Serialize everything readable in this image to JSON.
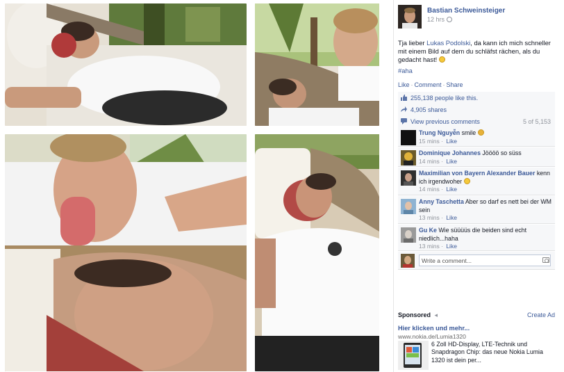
{
  "post": {
    "author": "Bastian Schweinsteiger",
    "time": "12 hrs",
    "text_prefix": "Tja lieber ",
    "mention": "Lukas Podolski",
    "text_suffix": ", da kann ich mich schneller mit einem Bild auf dem du schläfst rächen, als du gedacht hast! ",
    "hashtag": "#aha",
    "actions": {
      "like": "Like",
      "comment": "Comment",
      "share": "Share"
    },
    "likes_text": "255,138 people like this.",
    "shares_text": "4,905 shares",
    "view_previous": "View previous comments",
    "comment_count": "5 of 5,153",
    "write_placeholder": "Write a comment..."
  },
  "comments": [
    {
      "author": "Trung Nguyễn",
      "text": " smile ",
      "time": "15 mins",
      "like": "Like",
      "avatar_color": "#111111"
    },
    {
      "author": "Dominique Johannes",
      "text": " Jöööö so süss",
      "time": "14 mins",
      "like": "Like",
      "avatar_color": "#c9a22c"
    },
    {
      "author": "Maximilian von Bayern Alexander Bauer",
      "text": " kenn ich irgendwoher ",
      "time": "14 mins",
      "like": "Like",
      "avatar_color": "#3a3a3a"
    },
    {
      "author": "Anny Taschetta",
      "text": " Aber so darf es nett bei der WM sein",
      "time": "13 mins",
      "like": "Like",
      "avatar_color": "#7fa4c4"
    },
    {
      "author": "Gu Ke",
      "text": " Wie süüüüs die beiden sind echt niedlich...haha",
      "time": "13 mins",
      "like": "Like",
      "avatar_color": "#8c8c8c"
    }
  ],
  "sponsored": {
    "title": "Sponsored",
    "create_ad": "Create Ad",
    "ad_title": "Hier klicken und mehr...",
    "ad_url": "www.nokia.de/Lumia1320",
    "ad_text": "6 Zoll HD-Display, LTE-Technik und Snapdragon Chip: das neue Nokia Lumia 1320 ist dein per..."
  },
  "colors": {
    "link": "#3b5998",
    "meta": "#90949c",
    "panel": "#f6f7f9"
  }
}
